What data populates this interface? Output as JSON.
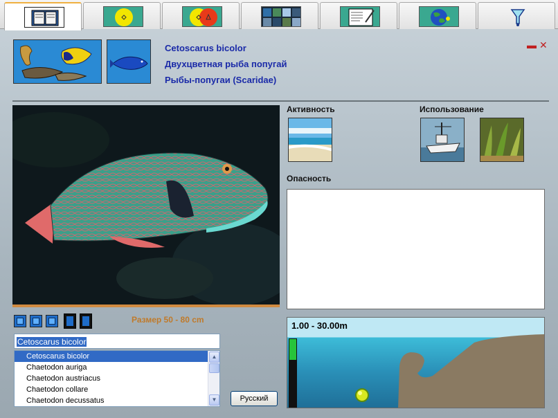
{
  "tabs": [
    {
      "id": "book",
      "icon": "book-icon",
      "active": true
    },
    {
      "id": "single-dot",
      "icon": "yellow-dot-icon",
      "active": false
    },
    {
      "id": "compare",
      "icon": "venn-circles-icon",
      "active": false
    },
    {
      "id": "gallery",
      "icon": "photo-grid-icon",
      "active": false
    },
    {
      "id": "notes",
      "icon": "notepad-pencil-icon",
      "active": false
    },
    {
      "id": "globe",
      "icon": "globe-icon",
      "active": false
    },
    {
      "id": "filter",
      "icon": "filter-funnel-icon",
      "active": false
    }
  ],
  "species": {
    "latin": "Cetoscarus bicolor",
    "common_ru": "Двухцветная рыба попугай",
    "family_ru": "Рыбы-попугаи (Scaridae)"
  },
  "photo": {
    "size_text": "Размер  50 - 80 cm"
  },
  "search": {
    "value": "Cetoscarus bicolor"
  },
  "species_list": [
    {
      "name": "Cetoscarus bicolor",
      "selected": true
    },
    {
      "name": "Chaetodon auriga",
      "selected": false
    },
    {
      "name": "Chaetodon austriacus",
      "selected": false
    },
    {
      "name": "Chaetodon collare",
      "selected": false
    },
    {
      "name": "Chaetodon decussatus",
      "selected": false
    }
  ],
  "language_button": "Русский",
  "sections": {
    "activity": "Активность",
    "usage": "Использование",
    "danger": "Опасность"
  },
  "depth": {
    "range_text": "1.00 - 30.00m",
    "min_m": 1.0,
    "max_m": 30.0
  },
  "colors": {
    "species_text": "#1a2aa8",
    "size_text": "#c07a2a",
    "selection": "#316ac5",
    "water_surface": "#bfe8f4",
    "water_deep": "#1f6f98",
    "seabed": "#8a7a62"
  }
}
